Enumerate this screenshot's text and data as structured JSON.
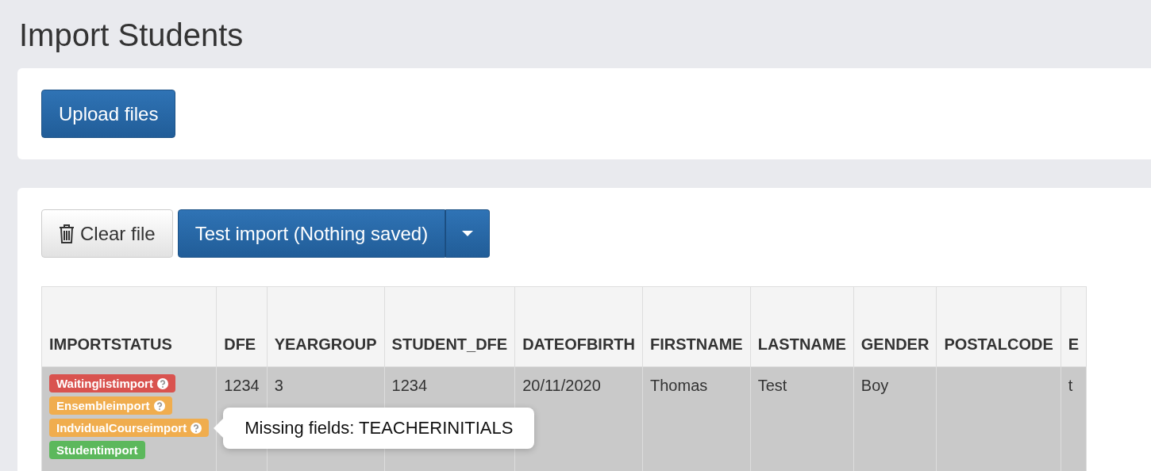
{
  "title": "Import Students",
  "upload_button": "Upload files",
  "toolbar": {
    "clear_button": "Clear file",
    "test_button": "Test import (Nothing saved)"
  },
  "table": {
    "columns": [
      "IMPORTSTATUS",
      "DFE",
      "YEARGROUP",
      "STUDENT_DFE",
      "DATEOFBIRTH",
      "FIRSTNAME",
      "LASTNAME",
      "GENDER",
      "POSTALCODE",
      "E"
    ],
    "rows": [
      {
        "cells": [
          {
            "statuses": [
              {
                "label": "Waitinglistimport",
                "color": "#d9534f",
                "help": true
              },
              {
                "label": "Ensembleimport",
                "color": "#f0ad4e",
                "help": true
              },
              {
                "label": "IndvidualCourseimport",
                "color": "#f0ad4e",
                "help": true,
                "tooltip": "Missing fields: TEACHERINITIALS"
              },
              {
                "label": "Studentimport",
                "color": "#5cb85c",
                "help": false
              }
            ]
          },
          "1234",
          "3",
          "1234",
          "20/11/2020",
          "Thomas",
          "Test",
          "Boy",
          "",
          "t"
        ]
      }
    ]
  }
}
